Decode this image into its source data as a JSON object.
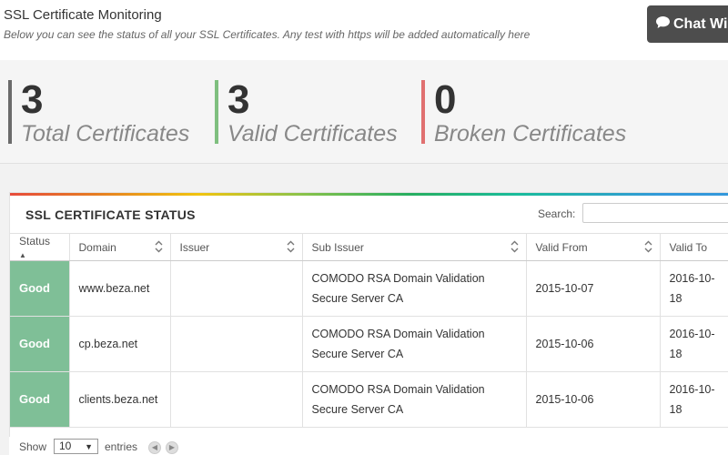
{
  "header": {
    "title": "SSL Certificate Monitoring",
    "subtitle": "Below you can see the status of all your SSL Certificates. Any test with https will be added automatically here",
    "chat_label": "Chat Wi"
  },
  "stats": [
    {
      "value": "3",
      "label": "Total Certificates",
      "color": "#6b6b6b"
    },
    {
      "value": "3",
      "label": "Valid Certificates",
      "color": "#7fbf7f"
    },
    {
      "value": "0",
      "label": "Broken Certificates",
      "color": "#e07070"
    }
  ],
  "panel": {
    "title": "SSL CERTIFICATE STATUS",
    "search_label": "Search:"
  },
  "table": {
    "columns": [
      "Status",
      "Domain",
      "Issuer",
      "Sub Issuer",
      "Valid From",
      "Valid To"
    ],
    "rows": [
      {
        "status": "Good",
        "domain": "www.beza.net",
        "issuer": "",
        "sub_issuer": "COMODO RSA Domain Validation Secure Server CA",
        "valid_from": "2015-10-07",
        "valid_to": "2016-10-18"
      },
      {
        "status": "Good",
        "domain": "cp.beza.net",
        "issuer": "",
        "sub_issuer": "COMODO RSA Domain Validation Secure Server CA",
        "valid_from": "2015-10-06",
        "valid_to": "2016-10-18"
      },
      {
        "status": "Good",
        "domain": "clients.beza.net",
        "issuer": "",
        "sub_issuer": "COMODO RSA Domain Validation Secure Server CA",
        "valid_from": "2015-10-06",
        "valid_to": "2016-10-18"
      }
    ]
  },
  "footer": {
    "show_label": "Show",
    "page_size": "10",
    "entries_label": "entries"
  },
  "colors": {
    "good": "#7fbf97",
    "chat_button": "#4d4d4d"
  }
}
